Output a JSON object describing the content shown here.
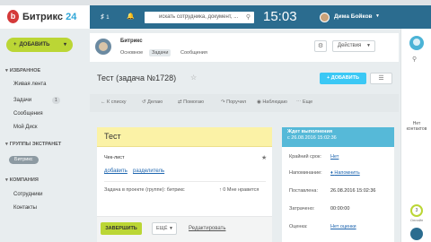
{
  "browser": {
    "bookmarks": [
      "",
      "",
      "",
      "",
      "",
      "",
      "",
      "",
      "",
      ""
    ]
  },
  "header": {
    "logo_text": "Битрикс",
    "logo_num": "24",
    "notify_count": "1",
    "search_value": "искать сотрудника, документ, ...",
    "time": "15:03",
    "user_name": "Дима Бойков"
  },
  "sidebar": {
    "add_label": "ДОБАВИТЬ",
    "favorites": "ИЗБРАННОЕ",
    "items": [
      {
        "label": "Живая лента"
      },
      {
        "label": "Задачи",
        "badge": "1"
      },
      {
        "label": "Сообщения"
      },
      {
        "label": "Мой Диск"
      }
    ],
    "extranet": "ГРУППЫ ЭКСТРАНЕТ",
    "group": "Битрикс",
    "company": "КОМПАНИЯ",
    "company_items": [
      {
        "label": "Сотрудники"
      },
      {
        "label": "Контакты"
      }
    ]
  },
  "crumb": {
    "title": "Битрикс",
    "tabs": [
      "Основное",
      "Задачи",
      "Сообщения"
    ],
    "actions": "Действия"
  },
  "task": {
    "page_title": "Тест (задача №1728)",
    "add_button": "ДОБАВИТЬ",
    "toolbar": [
      "К списку",
      "Делаю",
      "Помогаю",
      "Поручил",
      "Наблюдаю",
      "Еще"
    ],
    "card_title": "Тест",
    "checklist": "Чек-лист",
    "add_link": "добавить",
    "separator_link": "разделитель",
    "project_text": "Задача в проекте (группе):",
    "project_name": "битрикс",
    "likes": "0 Мне нравится",
    "finish": "ЗАВЕРШИТЬ",
    "more": "ЕЩЁ",
    "edit": "Редактировать"
  },
  "status": {
    "title": "Ждет выполнения",
    "since": "с 26.08.2016 15:02:36",
    "rows": [
      {
        "label": "Крайний срок:",
        "value": "Нет"
      },
      {
        "label": "Напоминание:",
        "value": "Напомнить"
      },
      {
        "label": "Поставлена:",
        "value": "26.08.2016 15:02:36"
      },
      {
        "label": "Затрачено:",
        "value": "00:00:00"
      },
      {
        "label": "Оценка:",
        "value": "Нет оценки"
      }
    ]
  },
  "rail": {
    "no_contacts": "Нет контактов",
    "online_count": "3",
    "online_label": "Онлайн"
  }
}
